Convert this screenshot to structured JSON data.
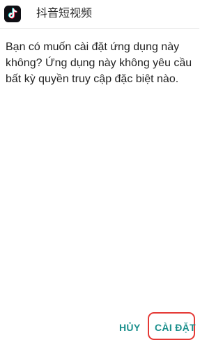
{
  "header": {
    "app_icon": "tiktok-icon",
    "app_name": "抖音短视频"
  },
  "dialog": {
    "message": "Bạn có muốn cài đặt ứng dụng này không? Ứng dụng này không yêu cầu bất kỳ quyền truy cập đặc biệt nào."
  },
  "actions": {
    "cancel_label": "HỦY",
    "install_label": "CÀI ĐẶT"
  },
  "colors": {
    "accent": "#1a8f8c",
    "highlight": "#e53935"
  }
}
